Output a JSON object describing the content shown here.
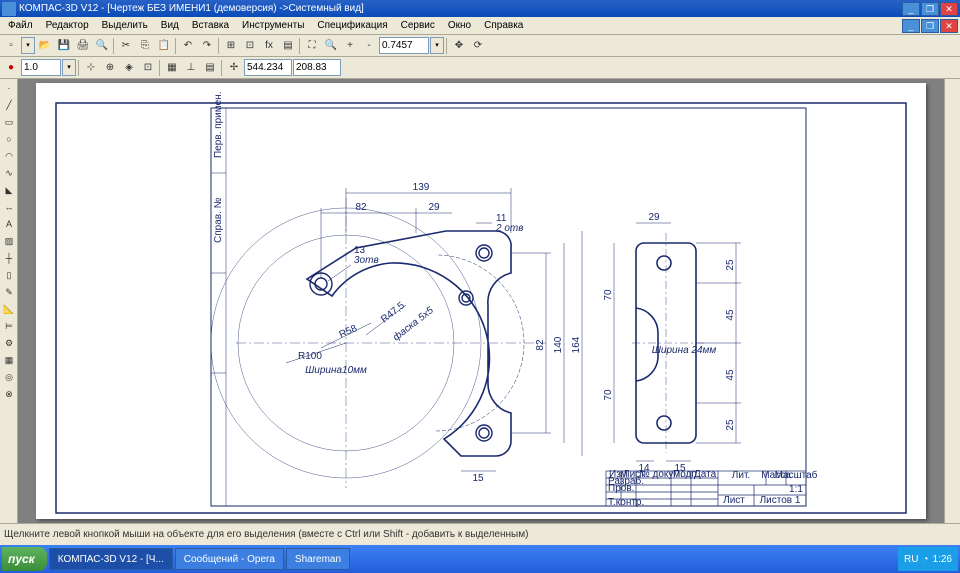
{
  "window": {
    "title": "КОМПАС-3D V12 - [Чертеж БЕЗ ИМЕНИ1 (демоверсия) ->Системный вид]"
  },
  "win_buttons": {
    "min": "_",
    "max": "❐",
    "close": "✕"
  },
  "menu": {
    "file": "Файл",
    "editor": "Редактор",
    "select": "Выделить",
    "view": "Вид",
    "insert": "Вставка",
    "tools": "Инструменты",
    "spec": "Спецификация",
    "service": "Сервис",
    "window": "Окно",
    "help": "Справка"
  },
  "toolbar_top": {
    "zoom": "0.7457",
    "coord_x": "544.234",
    "coord_y": "208.83"
  },
  "toolbar2": {
    "scale": "1.0"
  },
  "drawing_labels": {
    "d139": "139",
    "d82_top": "82",
    "d29_top": "29",
    "d11": "11",
    "d29_right": "29",
    "two_holes": "2 отв",
    "d13": "13",
    "three_holes": "3отв",
    "r100": "R100",
    "r58": "R58",
    "r475": "R47,5",
    "chamfer": "фаска 5х5",
    "width10": "Ширина10мм",
    "width24": "Ширина 24мм",
    "d82_v": "82",
    "d140": "140",
    "d164": "164",
    "d15": "15",
    "d70_t": "70",
    "d70_b": "70",
    "d25_t": "25",
    "d45_t": "45",
    "d45_b": "45",
    "d25_b": "25",
    "d14": "14",
    "d15_b": "15"
  },
  "title_block": {
    "h_izm": "Изм",
    "h_list": "Лист",
    "h_ndoc": "№ докум.",
    "h_podp": "Подп.",
    "h_data": "Дата",
    "razrab": "Разраб.",
    "prov": "Пров.",
    "tkontr": "Т.контр.",
    "lit": "Лит.",
    "massa": "Масса",
    "masshtab": "Масштаб",
    "scale": "1:1",
    "list": "Лист",
    "listov": "Листов 1"
  },
  "status": {
    "hint": "Щелкните левой кнопкой мыши на объекте для его выделения (вместе с Ctrl или Shift - добавить к выделенным)"
  },
  "taskbar": {
    "start": "пуск",
    "items": [
      "КОМПАС-3D V12 - [Ч...",
      "Сообщений - Opera",
      "Shareman"
    ],
    "lang": "RU",
    "time": "1:26"
  }
}
